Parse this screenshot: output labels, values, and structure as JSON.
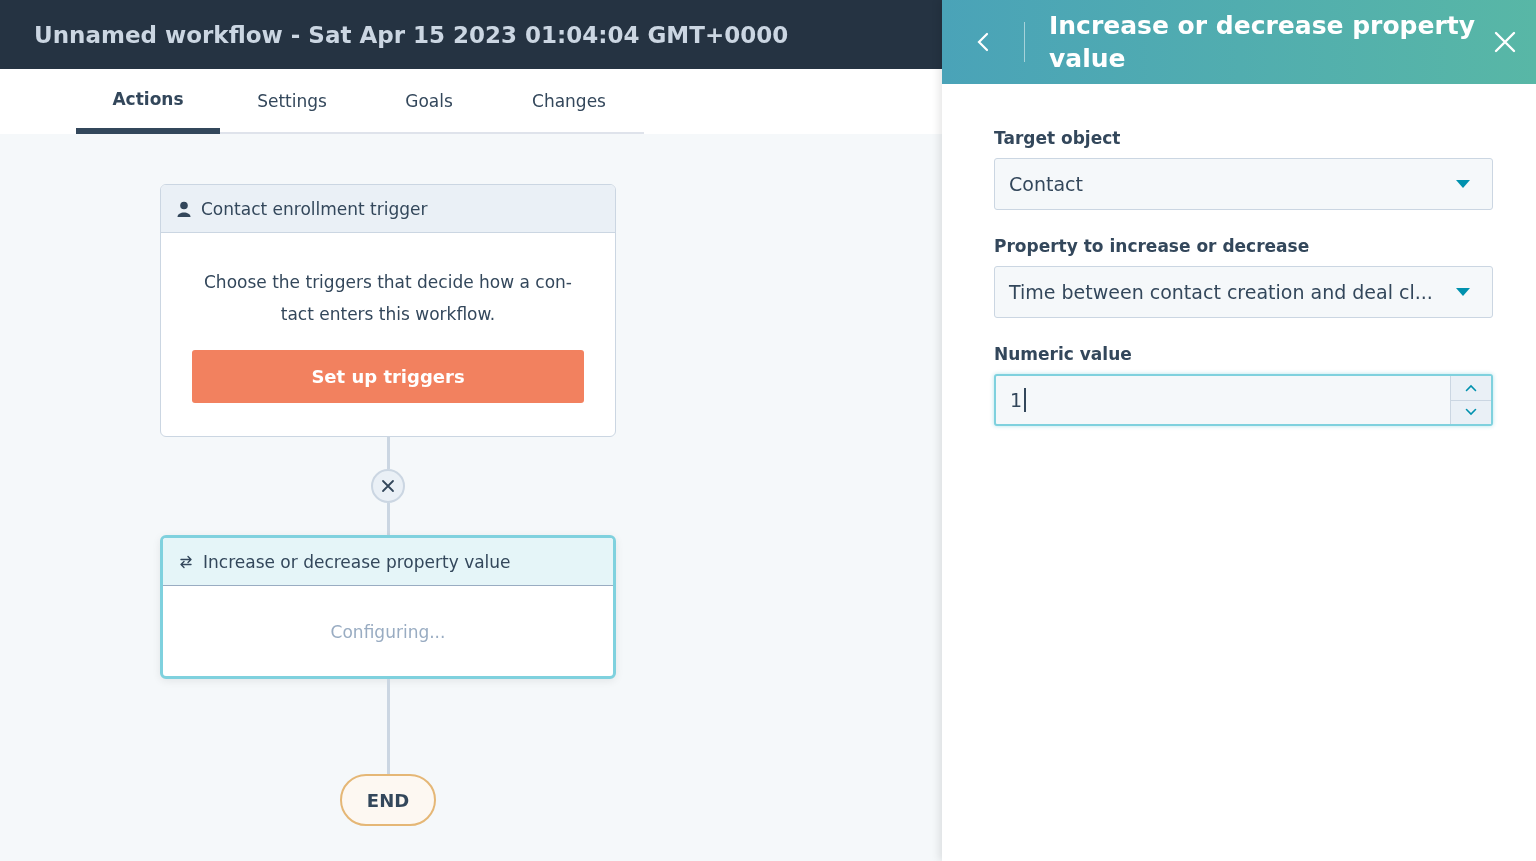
{
  "window": {
    "title": "Unnamed workflow - Sat Apr 15 2023 01:04:04 GMT+0000"
  },
  "tabs": [
    {
      "label": "Actions",
      "selected": true
    },
    {
      "label": "Settings",
      "selected": false
    },
    {
      "label": "Goals",
      "selected": false
    },
    {
      "label": "Changes",
      "selected": false
    }
  ],
  "workflow": {
    "nodes": [
      {
        "kind": "trigger",
        "title": "Contact enrollment trigger",
        "description": "Choose the triggers that decide how a con-tact enters this workflow.",
        "button": "Set up triggers",
        "selected": false
      },
      {
        "kind": "action",
        "title": "Increase or decrease property value",
        "status": "Configuring...",
        "selected": true
      }
    ],
    "end_label": "END"
  },
  "panel": {
    "title": "Increase or decrease property value",
    "fields": [
      {
        "kind": "select",
        "label": "Target object",
        "value": "Contact",
        "focused": false
      },
      {
        "kind": "select",
        "label": "Property to increase or decrease",
        "value": "Time between contact creation and deal cl...",
        "focused": false
      },
      {
        "kind": "number",
        "label": "Numeric value",
        "value": "1",
        "focused": true
      }
    ]
  }
}
